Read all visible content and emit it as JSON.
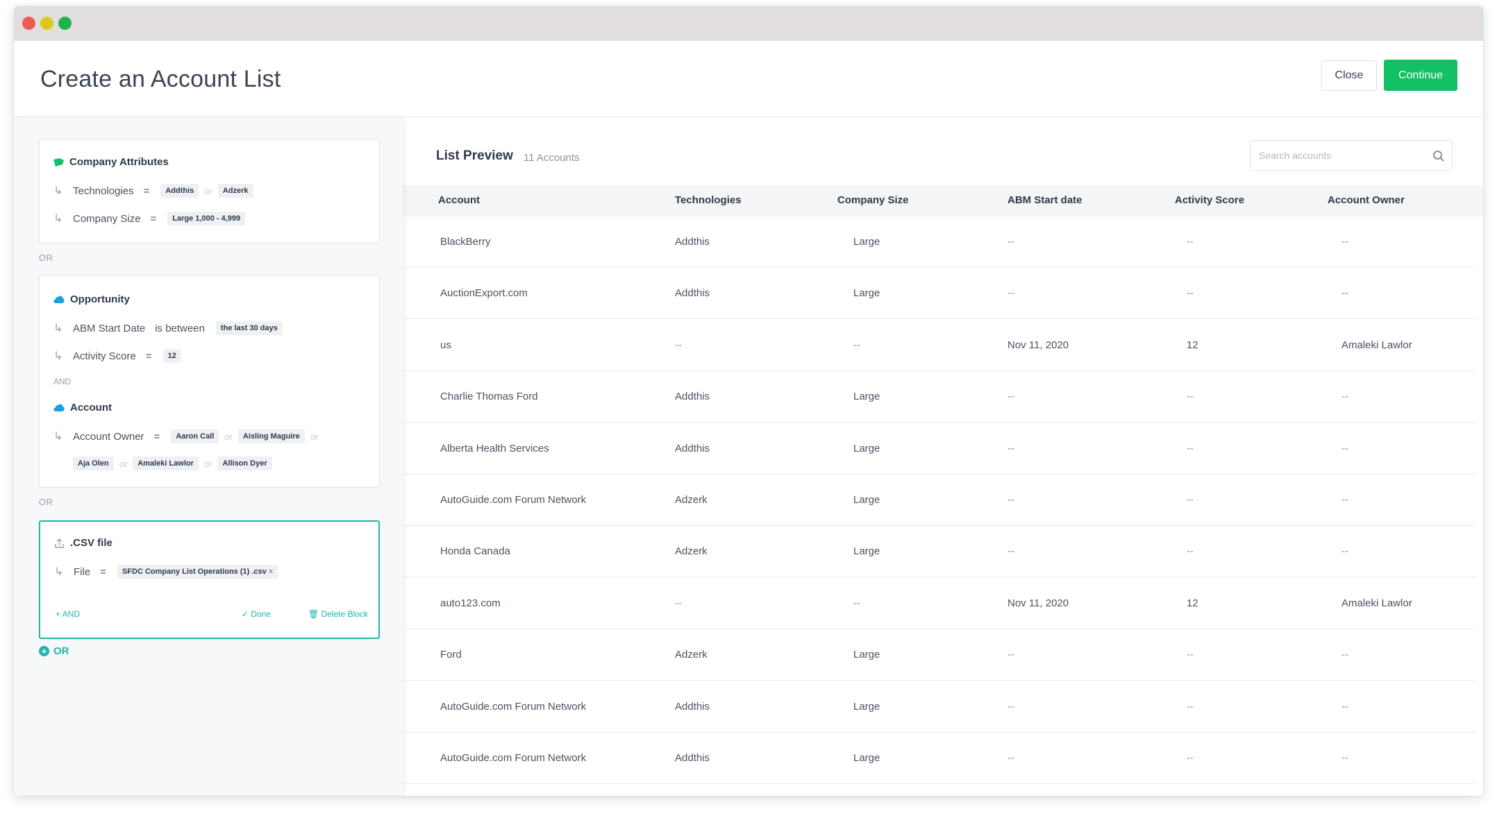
{
  "window": {
    "controls": [
      "close",
      "minimize",
      "maximize"
    ]
  },
  "header": {
    "title": "Create an Account List",
    "close_label": "Close",
    "continue_label": "Continue",
    "accent_color": "#12c163"
  },
  "builder": {
    "block1": {
      "title": "Company Attributes",
      "icon": "tag-icon",
      "cond1": {
        "field": "Technologies",
        "op": "=",
        "v1": "Addthis",
        "or1": "or",
        "v2": "Adzerk"
      },
      "cond2": {
        "field": "Company Size",
        "op": "=",
        "v1": "Large 1,000 - 4,999"
      }
    },
    "sep1": "OR",
    "block2": {
      "title1": "Opportunity",
      "icon": "salesforce-cloud-icon",
      "cond1": {
        "field": "ABM Start Date",
        "op": "is between",
        "v1": "the last 30 days"
      },
      "cond2": {
        "field": "Activity Score",
        "op": "=",
        "v1": "12"
      },
      "and": "AND",
      "title2": "Account",
      "cond3": {
        "field": "Account Owner",
        "op": "=",
        "v1": "Aaron Call",
        "or1": "or",
        "v2": "Aisling Maguire",
        "or2": "or",
        "v3": "Aja Olen",
        "or3": "or",
        "v4": "Amaleki Lawlor",
        "or4": "or",
        "v5": "Allison Dyer"
      }
    },
    "sep2": "OR",
    "block3": {
      "title": ".CSV file",
      "icon": "upload-icon",
      "cond1": {
        "field": "File",
        "op": "=",
        "v1": "SFDC Company List Operations (1) .csv",
        "remove": "×"
      },
      "add_and": "+ AND",
      "done": "✓ Done",
      "delete": "🗑 Delete Block"
    },
    "add_or": "OR"
  },
  "preview": {
    "title": "List Preview",
    "count": "11 Accounts",
    "search_placeholder": "Search accounts",
    "columns": [
      "Account",
      "Technologies",
      "Company Size",
      "ABM Start date",
      "Activity Score",
      "Account Owner"
    ],
    "rows": [
      [
        "BlackBerry",
        "Addthis",
        "Large",
        "--",
        "--",
        "--"
      ],
      [
        "AuctionExport.com",
        "Addthis",
        "Large",
        "--",
        "--",
        "--"
      ],
      [
        "us",
        "--",
        "--",
        "Nov 11, 2020",
        "12",
        "Amaleki Lawlor"
      ],
      [
        "Charlie Thomas Ford",
        "Addthis",
        "Large",
        "--",
        "--",
        "--"
      ],
      [
        "Alberta Health Services",
        "Addthis",
        "Large",
        "--",
        "--",
        "--"
      ],
      [
        "AutoGuide.com Forum Network",
        "Adzerk",
        "Large",
        "--",
        "--",
        "--"
      ],
      [
        "Honda Canada",
        "Adzerk",
        "Large",
        "--",
        "--",
        "--"
      ],
      [
        "auto123.com",
        "--",
        "--",
        "Nov 11, 2020",
        "12",
        "Amaleki Lawlor"
      ],
      [
        "Ford",
        "Adzerk",
        "Large",
        "--",
        "--",
        "--"
      ],
      [
        "AutoGuide.com Forum Network",
        "Addthis",
        "Large",
        "--",
        "--",
        "--"
      ],
      [
        "AutoGuide.com Forum Network",
        "Addthis",
        "Large",
        "--",
        "--",
        "--"
      ]
    ]
  }
}
